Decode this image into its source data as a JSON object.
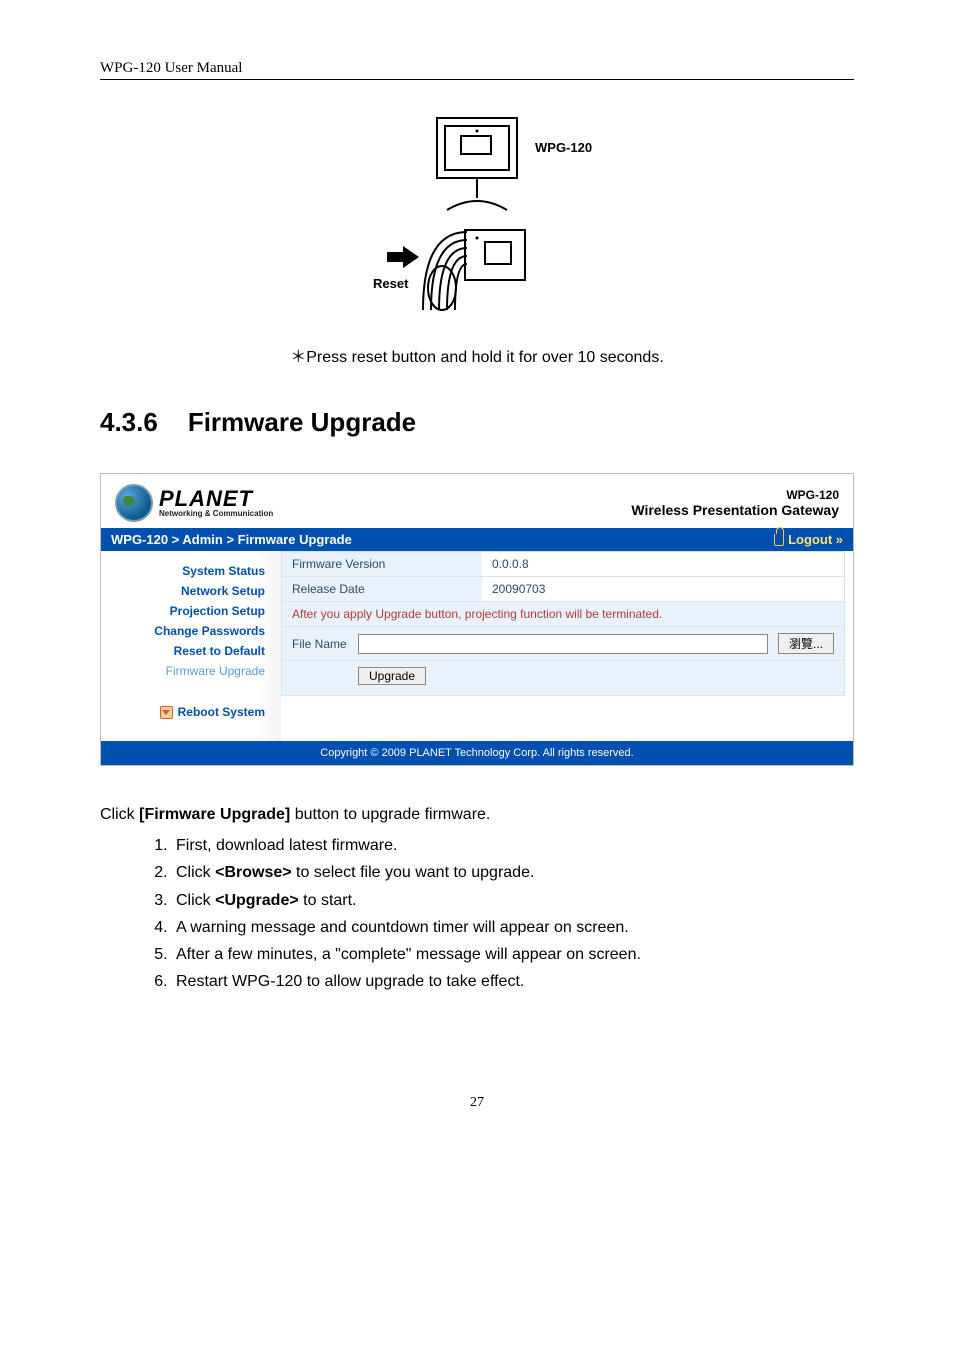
{
  "doc_header": "WPG-120 User Manual",
  "diagram": {
    "device_label": "WPG-120",
    "reset_label": "Reset"
  },
  "reset_caption": "＊Press reset button and hold it for over 10 seconds.",
  "section": {
    "number": "4.3.6",
    "title": "Firmware Upgrade"
  },
  "webui": {
    "logo": {
      "brand": "PLANET",
      "tagline": "Networking & Communication"
    },
    "top_right": {
      "model": "WPG-120",
      "tagline": "Wireless Presentation Gateway"
    },
    "breadcrumb": "WPG-120 > Admin > Firmware Upgrade",
    "logout": "Logout »",
    "sidebar": {
      "items": [
        "System Status",
        "Network Setup",
        "Projection Setup",
        "Change Passwords",
        "Reset to Default",
        "Firmware Upgrade"
      ],
      "reboot": "Reboot System"
    },
    "content": {
      "firmware_version_label": "Firmware Version",
      "firmware_version_value": "0.0.0.8",
      "release_date_label": "Release Date",
      "release_date_value": "20090703",
      "warning": "After you apply Upgrade button, projecting function will be terminated.",
      "file_name_label": "File Name",
      "file_name_value": "",
      "browse_button": "瀏覽...",
      "upgrade_button": "Upgrade"
    },
    "copyright": "Copyright © 2009 PLANET Technology Corp. All rights reserved."
  },
  "instructions": {
    "intro_pre": "Click ",
    "intro_bold": "[Firmware Upgrade]",
    "intro_post": " button to upgrade firmware.",
    "steps": [
      {
        "pre": "First, download latest firmware."
      },
      {
        "pre": "Click ",
        "bold": "<Browse>",
        "post": " to select file you want to upgrade."
      },
      {
        "pre": "Click ",
        "bold": "<Upgrade>",
        "post": " to start."
      },
      {
        "pre": "A warning message and countdown timer will appear on screen."
      },
      {
        "pre": "After a few minutes, a \"complete\" message will appear on screen."
      },
      {
        "pre": "Restart WPG-120 to allow upgrade to take effect."
      }
    ]
  },
  "page_number": "27"
}
